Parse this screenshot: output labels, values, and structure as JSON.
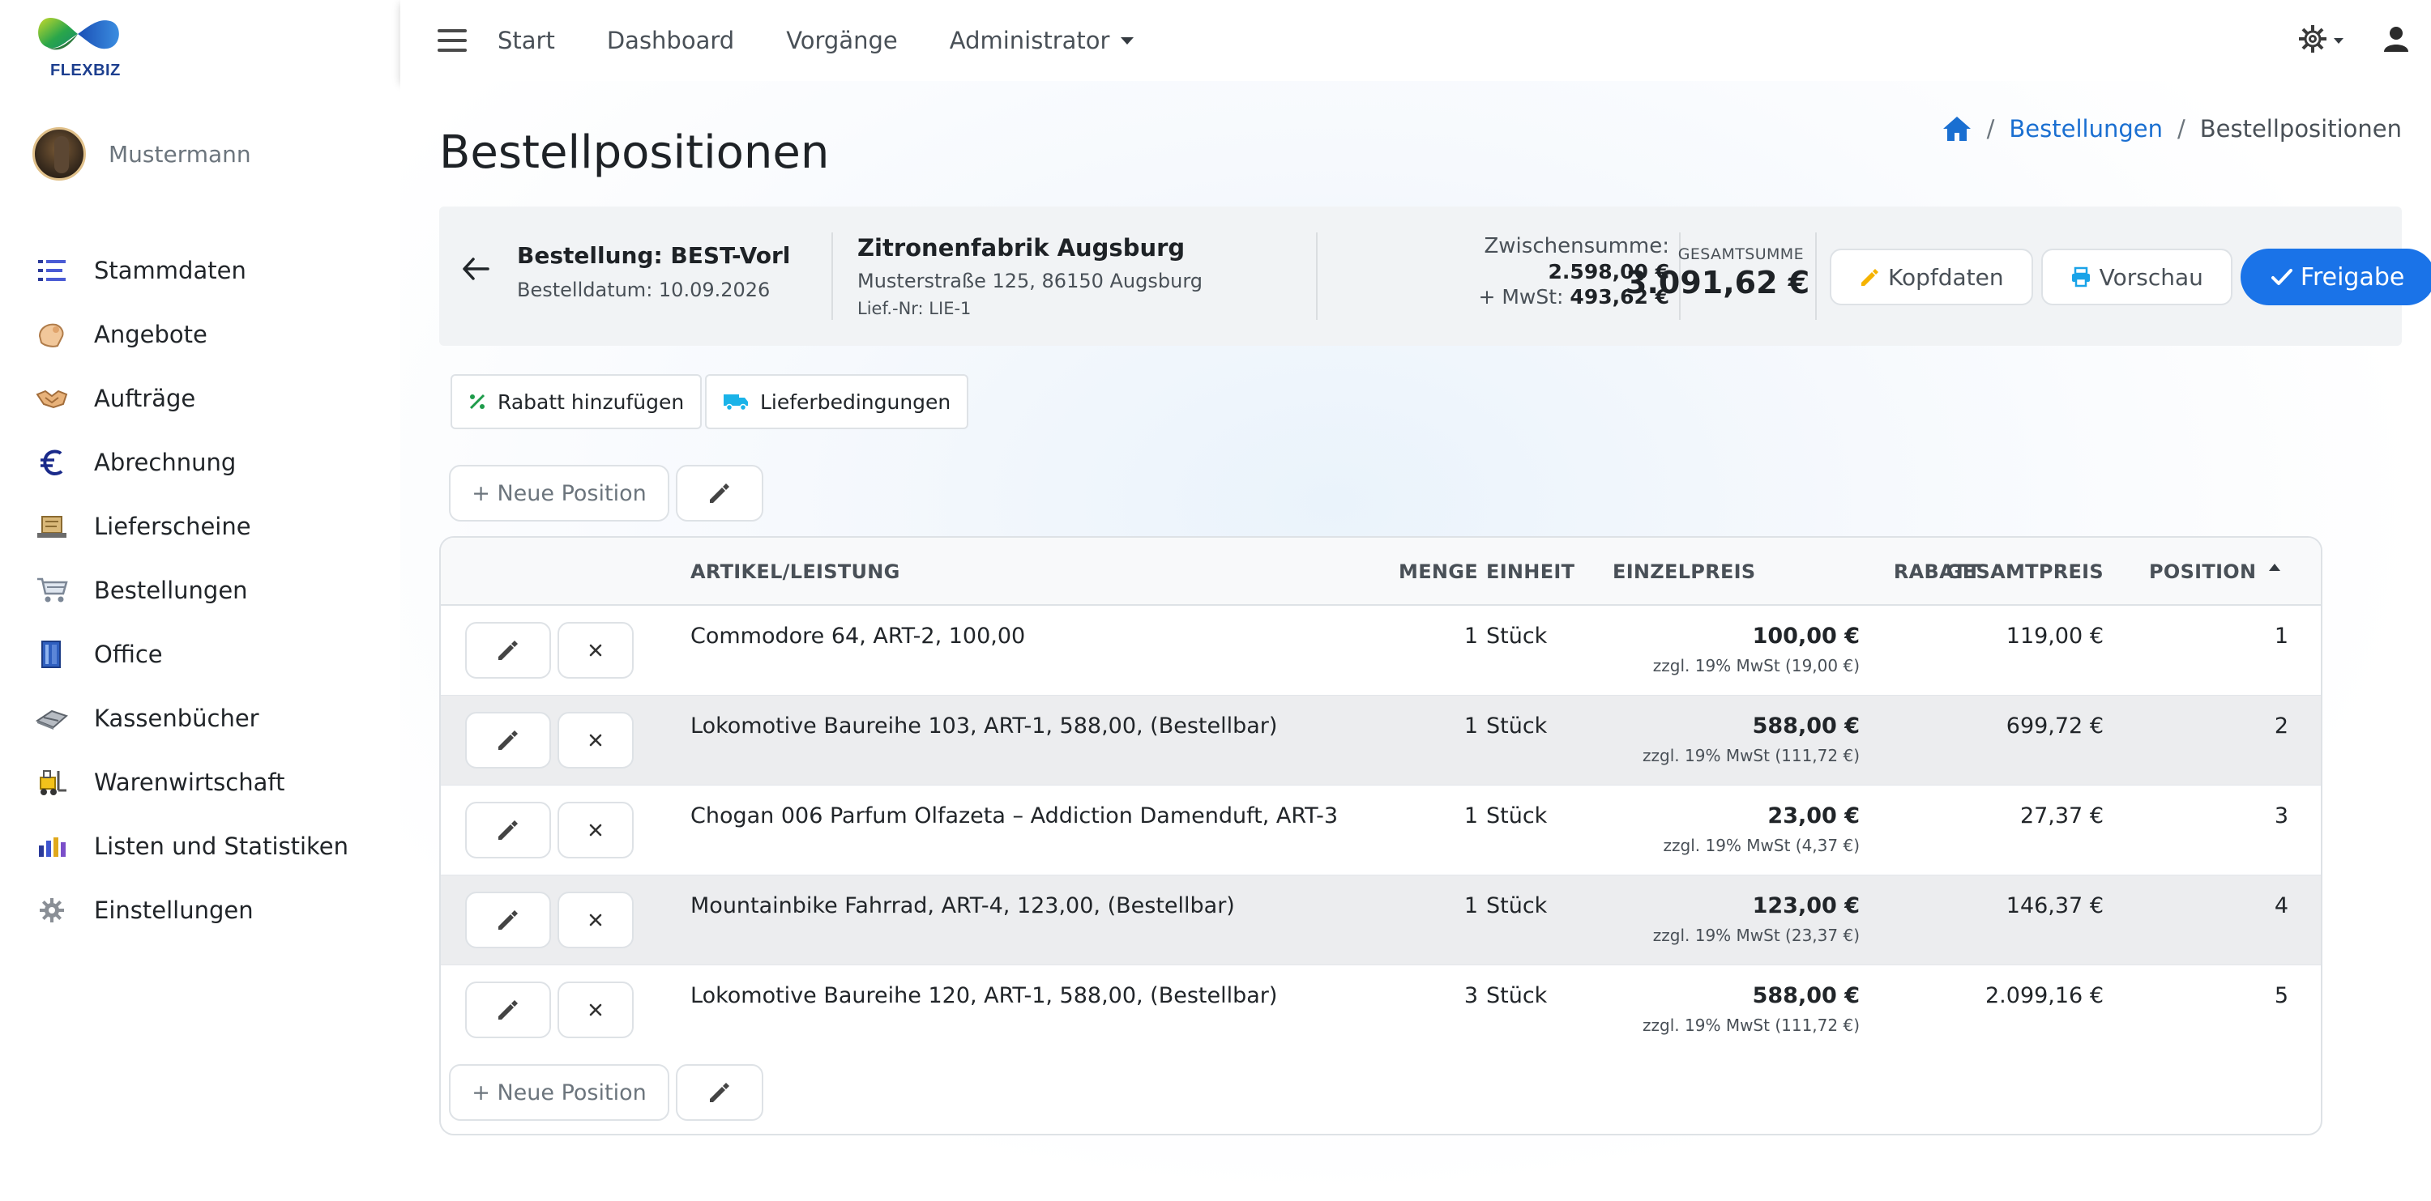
{
  "app": {
    "logo_text": "FLEXBIZ"
  },
  "user": {
    "name": "Mustermann"
  },
  "sidebar": {
    "items": [
      {
        "label": "Stammdaten",
        "icon": "list-icon"
      },
      {
        "label": "Angebote",
        "icon": "hand-offer-icon"
      },
      {
        "label": "Aufträge",
        "icon": "handshake-icon"
      },
      {
        "label": "Abrechnung",
        "icon": "euro-icon"
      },
      {
        "label": "Lieferscheine",
        "icon": "delivery-icon"
      },
      {
        "label": "Bestellungen",
        "icon": "cart-icon"
      },
      {
        "label": "Office",
        "icon": "office-icon"
      },
      {
        "label": "Kassenbücher",
        "icon": "cashbook-icon"
      },
      {
        "label": "Warenwirtschaft",
        "icon": "forklift-icon"
      },
      {
        "label": "Listen und Statistiken",
        "icon": "bar-chart-icon"
      },
      {
        "label": "Einstellungen",
        "icon": "gear-icon"
      }
    ]
  },
  "topnav": {
    "items": [
      "Start",
      "Dashboard",
      "Vorgänge",
      "Administrator"
    ]
  },
  "page": {
    "title": "Bestellpositionen"
  },
  "breadcrumb": {
    "link": "Bestellungen",
    "current": "Bestellpositionen",
    "sep": "/"
  },
  "order": {
    "number": "Bestellung: BEST-Vorl",
    "date": "Bestelldatum: 10.09.2026",
    "supplier_name": "Zitronenfabrik Augsburg",
    "supplier_address": "Musterstraße 125, 86150 Augsburg",
    "supplier_no": "Lief.-Nr: LIE-1",
    "subtotal_label": "Zwischensumme:",
    "subtotal_value": "2.598,00 €",
    "vat_label": "+ MwSt:",
    "vat_value": "493,62 €",
    "total_label": "GESAMTSUMME",
    "total_value": "3.091,62 €"
  },
  "actions": {
    "kopfdaten": "Kopfdaten",
    "vorschau": "Vorschau",
    "freigabe": "Freigabe",
    "rabatt": "Rabatt hinzufügen",
    "lieferbedingungen": "Lieferbedingungen",
    "neue_position": "+ Neue Position"
  },
  "table": {
    "headers": {
      "artikel": "ARTIKEL/LEISTUNG",
      "menge": "MENGE",
      "einheit": "EINHEIT",
      "einzelpreis": "EINZELPREIS",
      "rabatt": "RABATT",
      "gesamtpreis": "GESAMTPREIS",
      "position": "POSITION"
    },
    "rows": [
      {
        "artikel": "Commodore 64, ART-2, 100,00",
        "menge": "1",
        "einheit": "Stück",
        "einzelpreis": "100,00 €",
        "mwst": "zzgl. 19% MwSt (19,00 €)",
        "rabatt": "",
        "gesamtpreis": "119,00 €",
        "position": "1"
      },
      {
        "artikel": "Lokomotive Baureihe 103, ART-1, 588,00, (Bestellbar)",
        "menge": "1",
        "einheit": "Stück",
        "einzelpreis": "588,00 €",
        "mwst": "zzgl. 19% MwSt (111,72 €)",
        "rabatt": "",
        "gesamtpreis": "699,72 €",
        "position": "2"
      },
      {
        "artikel": "Chogan 006 Parfum Olfazeta – Addiction Damenduft, ART-3",
        "menge": "1",
        "einheit": "Stück",
        "einzelpreis": "23,00 €",
        "mwst": "zzgl. 19% MwSt (4,37 €)",
        "rabatt": "",
        "gesamtpreis": "27,37 €",
        "position": "3"
      },
      {
        "artikel": "Mountainbike Fahrrad, ART-4, 123,00, (Bestellbar)",
        "menge": "1",
        "einheit": "Stück",
        "einzelpreis": "123,00 €",
        "mwst": "zzgl. 19% MwSt (23,37 €)",
        "rabatt": "",
        "gesamtpreis": "146,37 €",
        "position": "4"
      },
      {
        "artikel": "Lokomotive Baureihe 120, ART-1, 588,00, (Bestellbar)",
        "menge": "3",
        "einheit": "Stück",
        "einzelpreis": "588,00 €",
        "mwst": "zzgl. 19% MwSt (111,72 €)",
        "rabatt": "",
        "gesamtpreis": "2.099,16 €",
        "position": "5"
      }
    ]
  },
  "colors": {
    "primary": "#1a73e8",
    "link": "#1a6fd1",
    "row_alt": "#ecedef"
  }
}
